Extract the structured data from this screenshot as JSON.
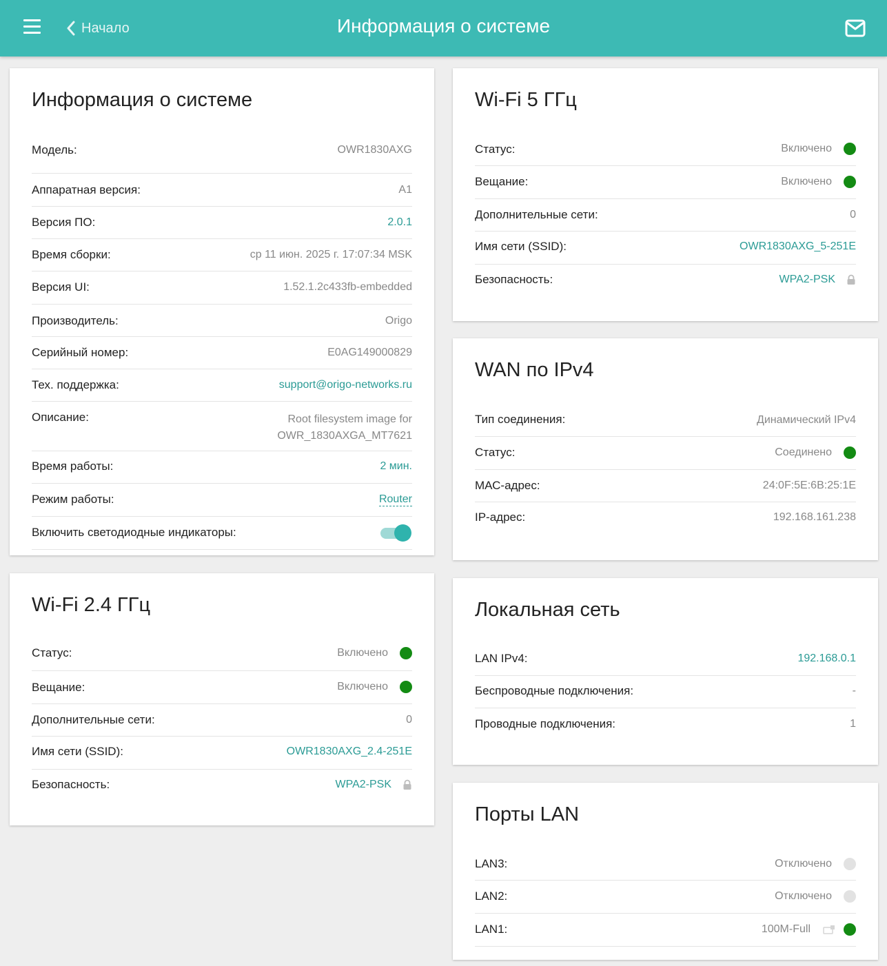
{
  "header": {
    "back_label": "Начало",
    "title": "Информация о системе"
  },
  "colors": {
    "accent": "#3dbab4",
    "link": "#2b9b95",
    "status_on": "#138b13",
    "status_off": "#e2e2e2"
  },
  "system": {
    "title": "Информация о системе",
    "rows": [
      {
        "label": "Модель:",
        "value": "OWR1830AXG"
      },
      {
        "label": "Аппаратная версия:",
        "value": "A1"
      },
      {
        "label": "Версия ПО:",
        "value": "2.0.1"
      },
      {
        "label": "Время сборки:",
        "value": "ср 11 июн. 2025 г. 17:07:34 MSK"
      },
      {
        "label": "Версия UI:",
        "value": "1.52.1.2c433fb-embedded"
      },
      {
        "label": "Производитель:",
        "value": "Origo"
      },
      {
        "label": "Серийный номер:",
        "value": "E0AG149000829"
      },
      {
        "label": "Тех. поддержка:",
        "value": "support@origo-networks.ru"
      },
      {
        "label": "Описание:",
        "value_line1": "Root filesystem image for",
        "value_line2": "OWR_1830AXGA_MT7621"
      },
      {
        "label": "Время работы:",
        "value": "2 мин."
      },
      {
        "label": "Режим работы:",
        "value": "Router"
      },
      {
        "label": "Включить светодиодные индикаторы:",
        "toggle_on": true
      }
    ]
  },
  "wifi24": {
    "title": "Wi-Fi 2.4 ГГц",
    "rows": [
      {
        "label": "Статус:",
        "value": "Включено"
      },
      {
        "label": "Вещание:",
        "value": "Включено"
      },
      {
        "label": "Дополнительные сети:",
        "value": "0"
      },
      {
        "label": "Имя сети (SSID):",
        "value": "OWR1830AXG_2.4-251E"
      },
      {
        "label": "Безопасность:",
        "value": "WPA2-PSK"
      }
    ]
  },
  "wifi5": {
    "title": "Wi-Fi 5 ГГц",
    "rows": [
      {
        "label": "Статус:",
        "value": "Включено"
      },
      {
        "label": "Вещание:",
        "value": "Включено"
      },
      {
        "label": "Дополнительные сети:",
        "value": "0"
      },
      {
        "label": "Имя сети (SSID):",
        "value": "OWR1830AXG_5-251E"
      },
      {
        "label": "Безопасность:",
        "value": "WPA2-PSK"
      }
    ]
  },
  "wan": {
    "title": "WAN по IPv4",
    "rows": [
      {
        "label": "Тип соединения:",
        "value": "Динамический IPv4"
      },
      {
        "label": "Статус:",
        "value": "Соединено"
      },
      {
        "label": "МАС-адрес:",
        "value": "24:0F:5E:6B:25:1E"
      },
      {
        "label": "IP-адрес:",
        "value": "192.168.161.238"
      }
    ]
  },
  "lan": {
    "title": "Локальная сеть",
    "rows": [
      {
        "label": "LAN IPv4:",
        "value": "192.168.0.1"
      },
      {
        "label": "Беспроводные подключения:",
        "value": "-"
      },
      {
        "label": "Проводные подключения:",
        "value": "1"
      }
    ]
  },
  "ports": {
    "title": "Порты LAN",
    "rows": [
      {
        "label": "LAN3:",
        "value": "Отключено"
      },
      {
        "label": "LAN2:",
        "value": "Отключено"
      },
      {
        "label": "LAN1:",
        "value": "100M-Full"
      }
    ]
  }
}
